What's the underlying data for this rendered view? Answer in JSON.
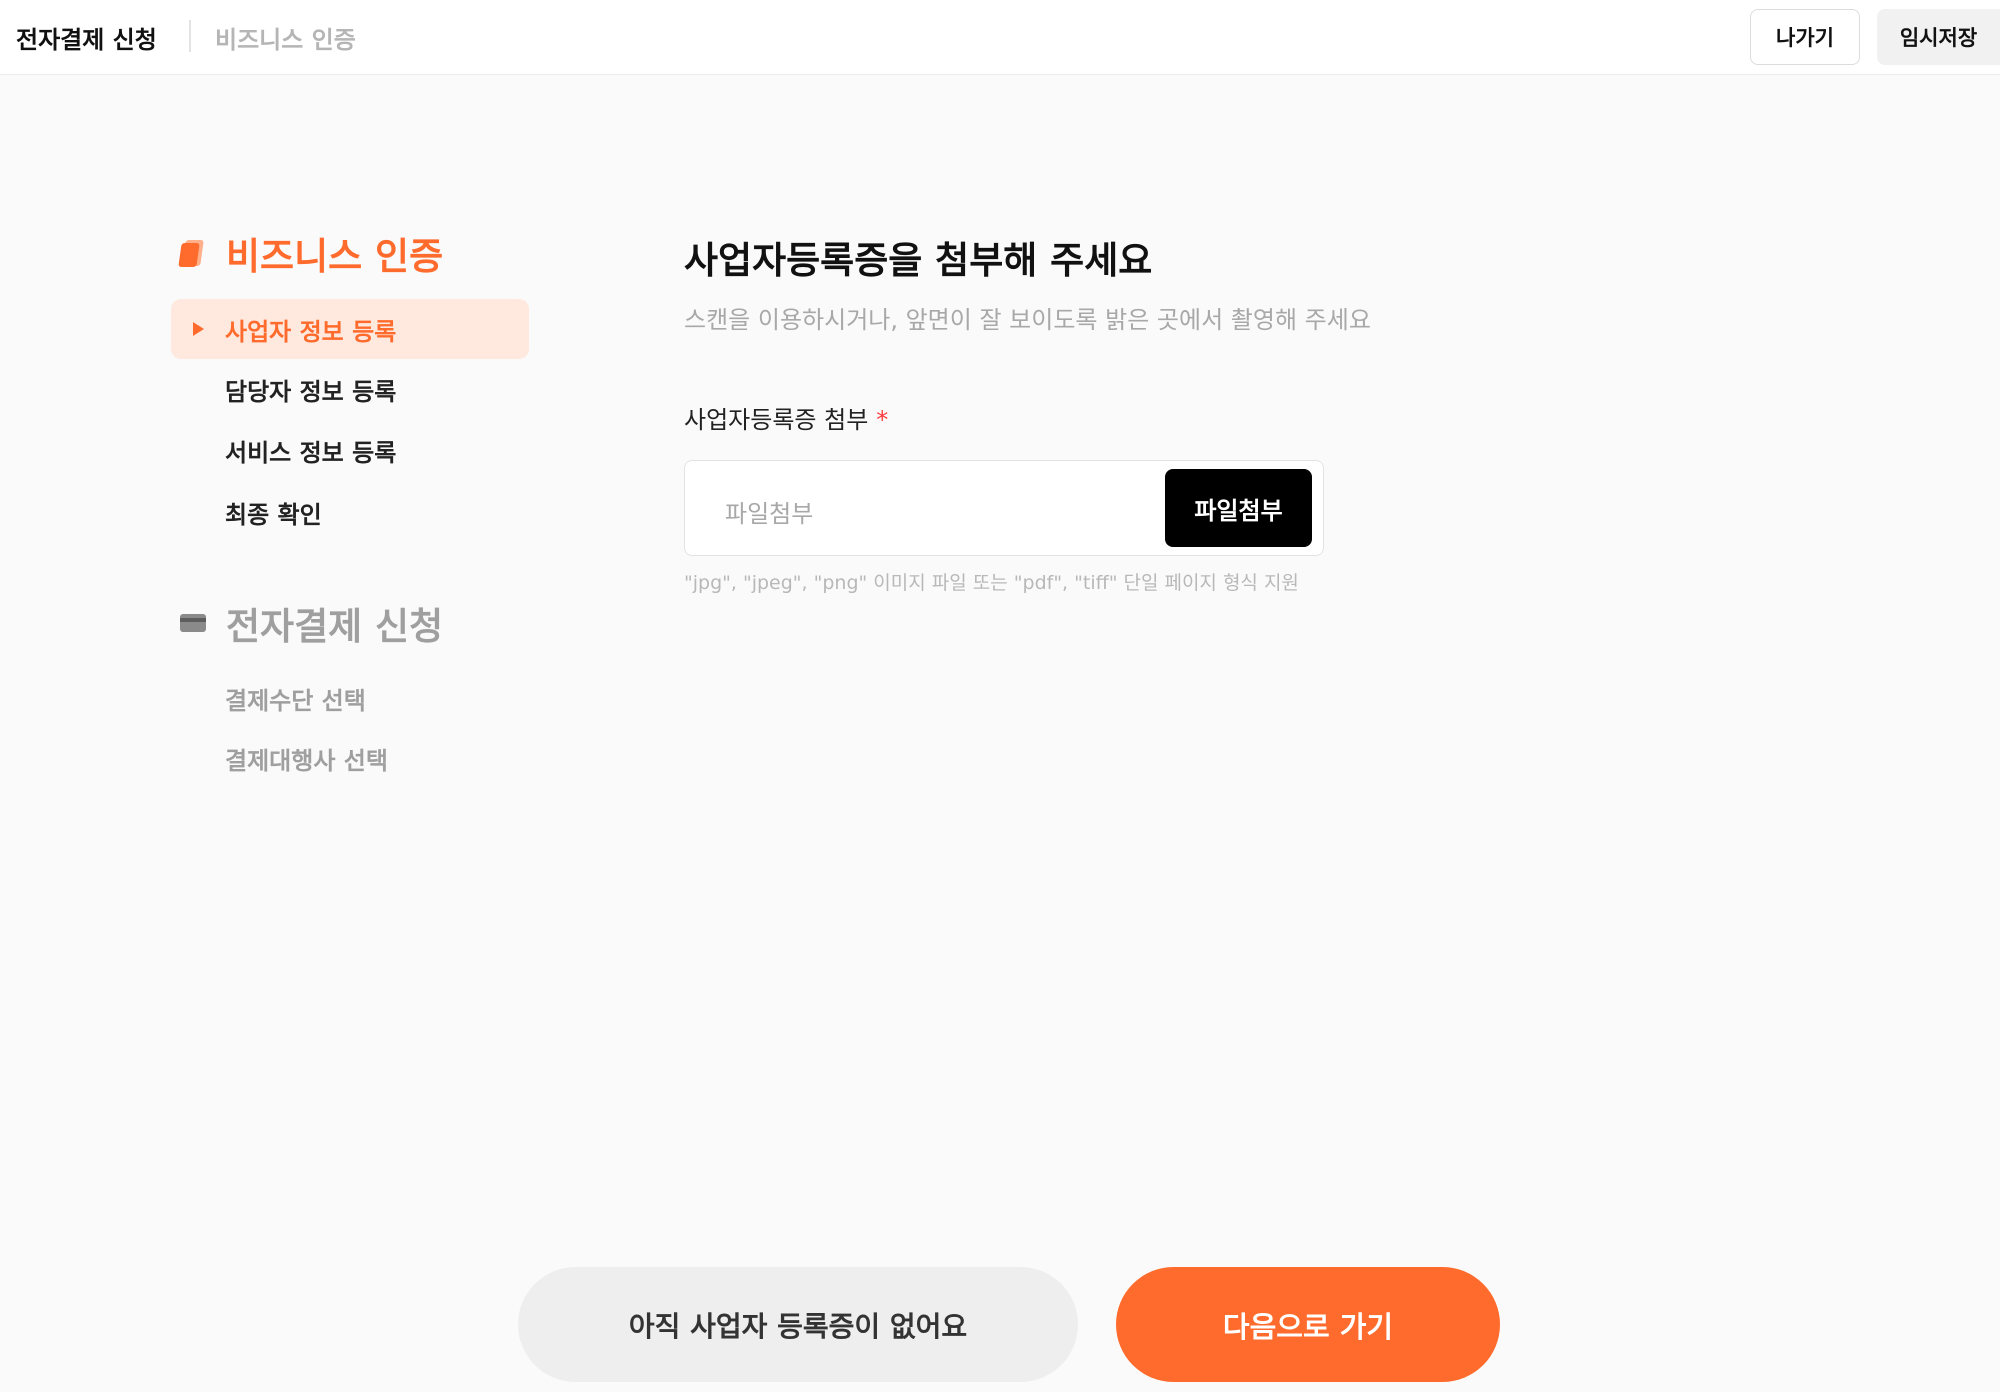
{
  "header": {
    "title": "전자결제 신청",
    "subtitle": "비즈니스 인증",
    "exit_label": "나가기",
    "save_label": "임시저장"
  },
  "sidebar": {
    "sections": [
      {
        "title": "비즈니스 인증",
        "icon": "document-icon",
        "items": [
          {
            "label": "사업자 정보 등록",
            "state": "selected"
          },
          {
            "label": "담당자 정보 등록",
            "state": "normal"
          },
          {
            "label": "서비스 정보 등록",
            "state": "normal"
          },
          {
            "label": "최종 확인",
            "state": "normal"
          }
        ]
      },
      {
        "title": "전자결제 신청",
        "icon": "card-icon",
        "items": [
          {
            "label": "결제수단 선택",
            "state": "disabled"
          },
          {
            "label": "결제대행사 선택",
            "state": "disabled"
          }
        ]
      }
    ]
  },
  "main": {
    "title": "사업자등록증을 첨부해 주세요",
    "subtitle": "스캔을 이용하시거나, 앞면이 잘 보이도록 밝은 곳에서 촬영해 주세요",
    "field_label": "사업자등록증 첨부",
    "required_mark": "*",
    "file_placeholder": "파일첨부",
    "file_button_label": "파일첨부",
    "hint": "\"jpg\", \"jpeg\", \"png\" 이미지 파일 또는 \"pdf\", \"tiff\" 단일 페이지 형식 지원"
  },
  "footer": {
    "secondary_label": "아직 사업자 등록증이 없어요",
    "primary_label": "다음으로 가기"
  },
  "colors": {
    "accent": "#ff6b2c",
    "accent_soft": "#ffe9df",
    "muted": "#9f9f9f",
    "required": "#ff3b3b"
  }
}
